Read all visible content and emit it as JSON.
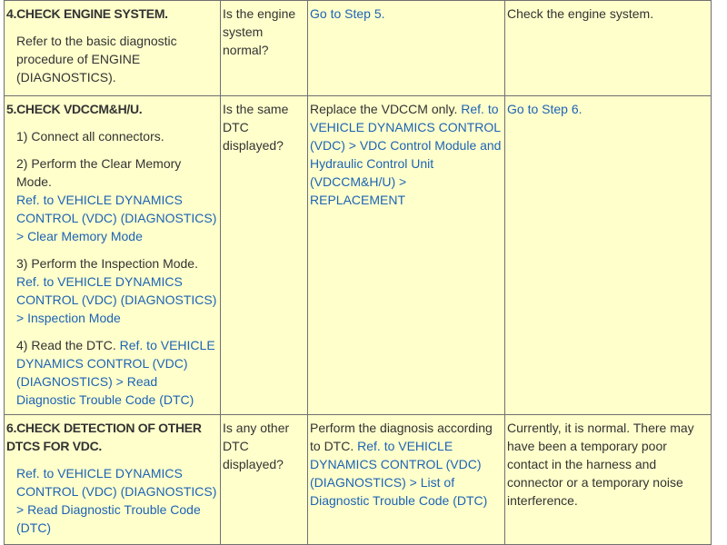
{
  "rows": [
    {
      "step_title": "4.CHECK ENGINE SYSTEM.",
      "body": [
        {
          "text": "Refer to the basic diagnostic procedure of ENGINE (DIAGNOSTICS).",
          "link": ""
        }
      ],
      "question": "Is the engine system normal?",
      "yes": {
        "text": "",
        "link": "Go to Step 5."
      },
      "no": {
        "text": "Check the engine system.",
        "link": ""
      }
    },
    {
      "step_title": "5.CHECK VDCCM&H/U.",
      "body": [
        {
          "text": "1) Connect all connectors.",
          "link": ""
        },
        {
          "text": "2) Perform the Clear Memory Mode.",
          "link": "Ref. to VEHICLE DYNAMICS CONTROL (VDC) (DIAGNOSTICS) > Clear Memory Mode"
        },
        {
          "text": "3) Perform the Inspection Mode.",
          "link": "Ref. to VEHICLE DYNAMICS CONTROL (VDC) (DIAGNOSTICS) > Inspection Mode"
        },
        {
          "text": "4) Read the DTC.",
          "link": "Ref. to VEHICLE DYNAMICS CONTROL (VDC) (DIAGNOSTICS) > Read Diagnostic Trouble Code (DTC)"
        }
      ],
      "question": "Is the same DTC displayed?",
      "yes": {
        "text": "Replace the VDCCM only.",
        "link": "Ref. to VEHICLE DYNAMICS CONTROL (VDC) > VDC Control Module and Hydraulic Control Unit (VDCCM&H/U) > REPLACEMENT"
      },
      "no": {
        "text": "",
        "link": "Go to Step 6."
      }
    },
    {
      "step_title": "6.CHECK DETECTION OF OTHER DTCS FOR VDC.",
      "body": [
        {
          "text": "",
          "link": "Ref. to VEHICLE DYNAMICS CONTROL (VDC) (DIAGNOSTICS) > Read Diagnostic Trouble Code (DTC)"
        }
      ],
      "question": "Is any other DTC displayed?",
      "yes": {
        "text": "Perform the diagnosis according to DTC.",
        "link": "Ref. to VEHICLE DYNAMICS CONTROL (VDC) (DIAGNOSTICS) > List of Diagnostic Trouble Code (DTC)"
      },
      "no": {
        "text": "Currently, it is normal. There may have been a temporary poor contact in the harness and connector or a temporary noise interference.",
        "link": ""
      }
    }
  ],
  "colors": {
    "cell_bg": "#ffffcc",
    "link": "#1d63b5",
    "border": "#707070",
    "text": "#333333"
  }
}
